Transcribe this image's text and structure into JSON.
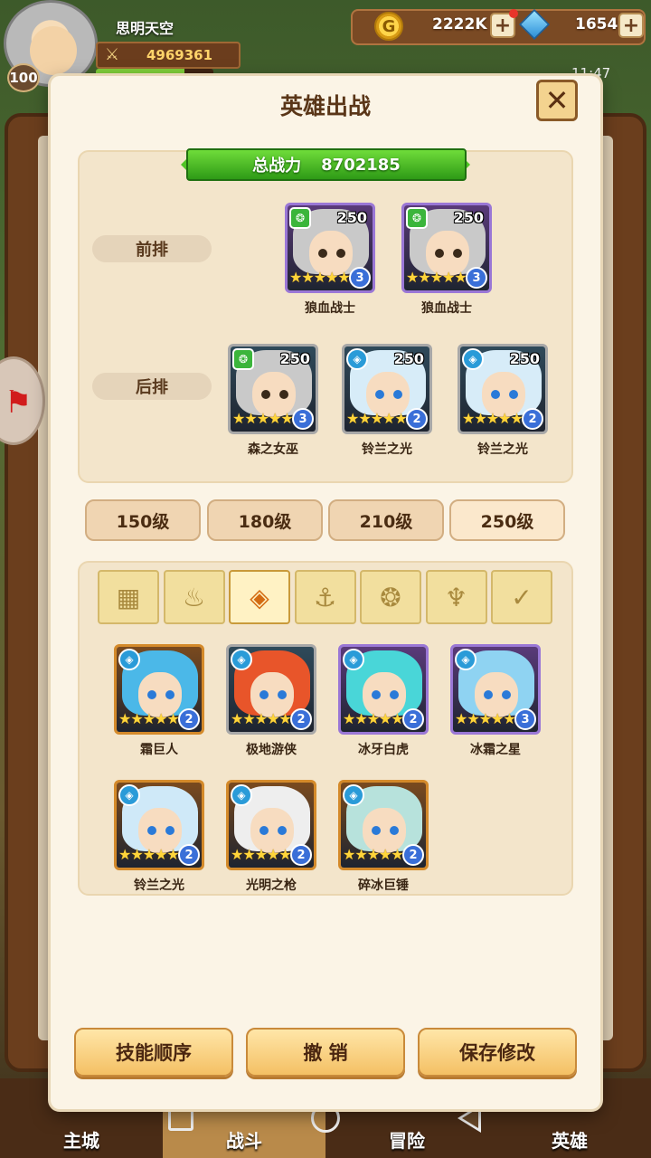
{
  "player": {
    "name": "思明天空",
    "level": "100",
    "power": "4969361"
  },
  "resources": {
    "gold": "2222K",
    "gems": "1654",
    "coin_symbol": "G"
  },
  "status_bar": {
    "time": "11:47"
  },
  "modal": {
    "title": "英雄出战",
    "total_power_label": "总战力",
    "total_power_value": "8702185",
    "front_row_label": "前排",
    "back_row_label": "后排"
  },
  "front_row": [
    {
      "name": "狼血战士",
      "level": "250",
      "stars": 5,
      "rank": "3",
      "faction": "beast",
      "frame": "purple"
    },
    {
      "name": "狼血战士",
      "level": "250",
      "stars": 5,
      "rank": "3",
      "faction": "beast",
      "frame": "purple"
    }
  ],
  "back_row": [
    {
      "name": "森之女巫",
      "level": "250",
      "stars": 5,
      "rank": "3",
      "faction": "beast",
      "frame": "gray"
    },
    {
      "name": "铃兰之光",
      "level": "250",
      "stars": 5,
      "rank": "2",
      "faction": "ice",
      "frame": "gray"
    },
    {
      "name": "铃兰之光",
      "level": "250",
      "stars": 5,
      "rank": "2",
      "faction": "ice",
      "frame": "gray"
    }
  ],
  "level_filters": [
    "150级",
    "180级",
    "210级",
    "250级"
  ],
  "faction_tabs": [
    {
      "icon": "grid-icon",
      "glyph": "▦"
    },
    {
      "icon": "nature-icon",
      "glyph": "♨"
    },
    {
      "icon": "ice-icon",
      "glyph": "◈"
    },
    {
      "icon": "anchor-icon",
      "glyph": "⚓"
    },
    {
      "icon": "beast-icon",
      "glyph": "❂"
    },
    {
      "icon": "demon-icon",
      "glyph": "♆"
    },
    {
      "icon": "wing-icon",
      "glyph": "✓"
    }
  ],
  "roster": [
    {
      "name": "霜巨人",
      "stars": 5,
      "rank": "2",
      "frame": "orange",
      "hair": "#4bb8e8"
    },
    {
      "name": "极地游侠",
      "stars": 5,
      "rank": "2",
      "frame": "gray",
      "hair": "#e8552a"
    },
    {
      "name": "冰牙白虎",
      "stars": 5,
      "rank": "2",
      "frame": "purple",
      "hair": "#49d6d8"
    },
    {
      "name": "冰霜之星",
      "stars": 5,
      "rank": "3",
      "frame": "purple",
      "hair": "#8fd3f2"
    },
    {
      "name": "铃兰之光",
      "stars": 5,
      "rank": "2",
      "frame": "orange",
      "hair": "#cfe9f8"
    },
    {
      "name": "光明之枪",
      "stars": 5,
      "rank": "2",
      "frame": "orange",
      "hair": "#eeeeee"
    },
    {
      "name": "碎冰巨锤",
      "stars": 5,
      "rank": "2",
      "frame": "orange",
      "hair": "#b7e2dc"
    }
  ],
  "actions": {
    "skill_order": "技能顺序",
    "cancel": "撤 销",
    "save": "保存修改"
  },
  "bottom_nav": [
    "主城",
    "战斗",
    "冒险",
    "英雄"
  ],
  "colors": {
    "accent_green": "#4fc426",
    "panel": "#f3e5cb",
    "button": "#f4c064"
  }
}
